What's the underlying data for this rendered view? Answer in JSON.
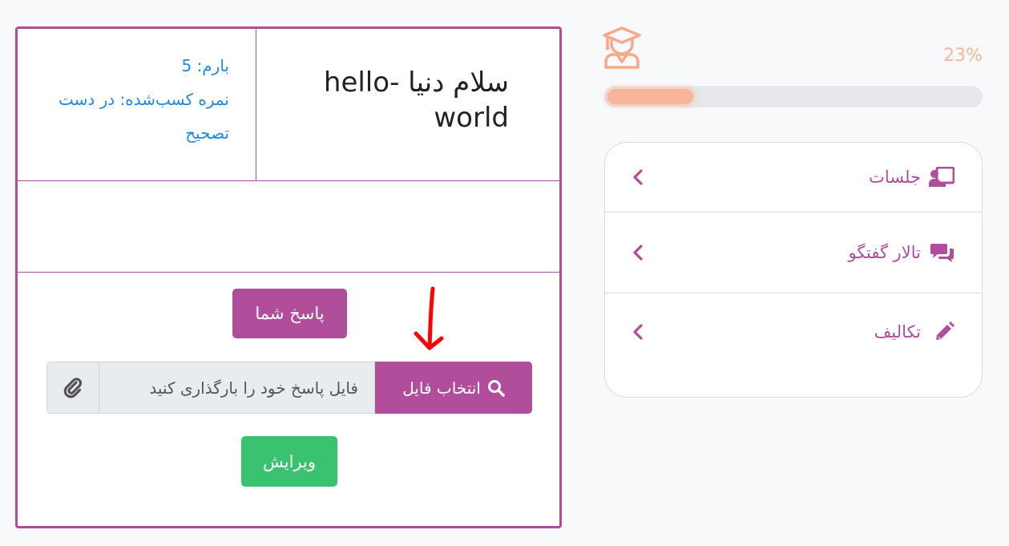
{
  "assignment": {
    "title": "سلام دنیا -hello world",
    "weight_line": "بارم: 5",
    "grade_line": "نمره کسب‌شده: در دست تصحیح",
    "answer_button": "پاسخ شما",
    "file_input": {
      "placeholder": "فایل پاسخ خود را بارگذاری کنید",
      "choose_label": "انتخاب فایل"
    },
    "edit_button": "ویرایش"
  },
  "sidebar": {
    "progress": {
      "label": "23%",
      "percent": 23
    },
    "menu": [
      {
        "label": "جلسات",
        "icon": "chalkboard-teacher-icon"
      },
      {
        "label": "تالار گفتگو",
        "icon": "comments-icon"
      },
      {
        "label": "تکالیف",
        "icon": "pencil-icon"
      }
    ]
  },
  "colors": {
    "brand": "#b14e9b",
    "link": "#1e88e5",
    "success": "#3ac270",
    "progress": "#f9b59a"
  }
}
